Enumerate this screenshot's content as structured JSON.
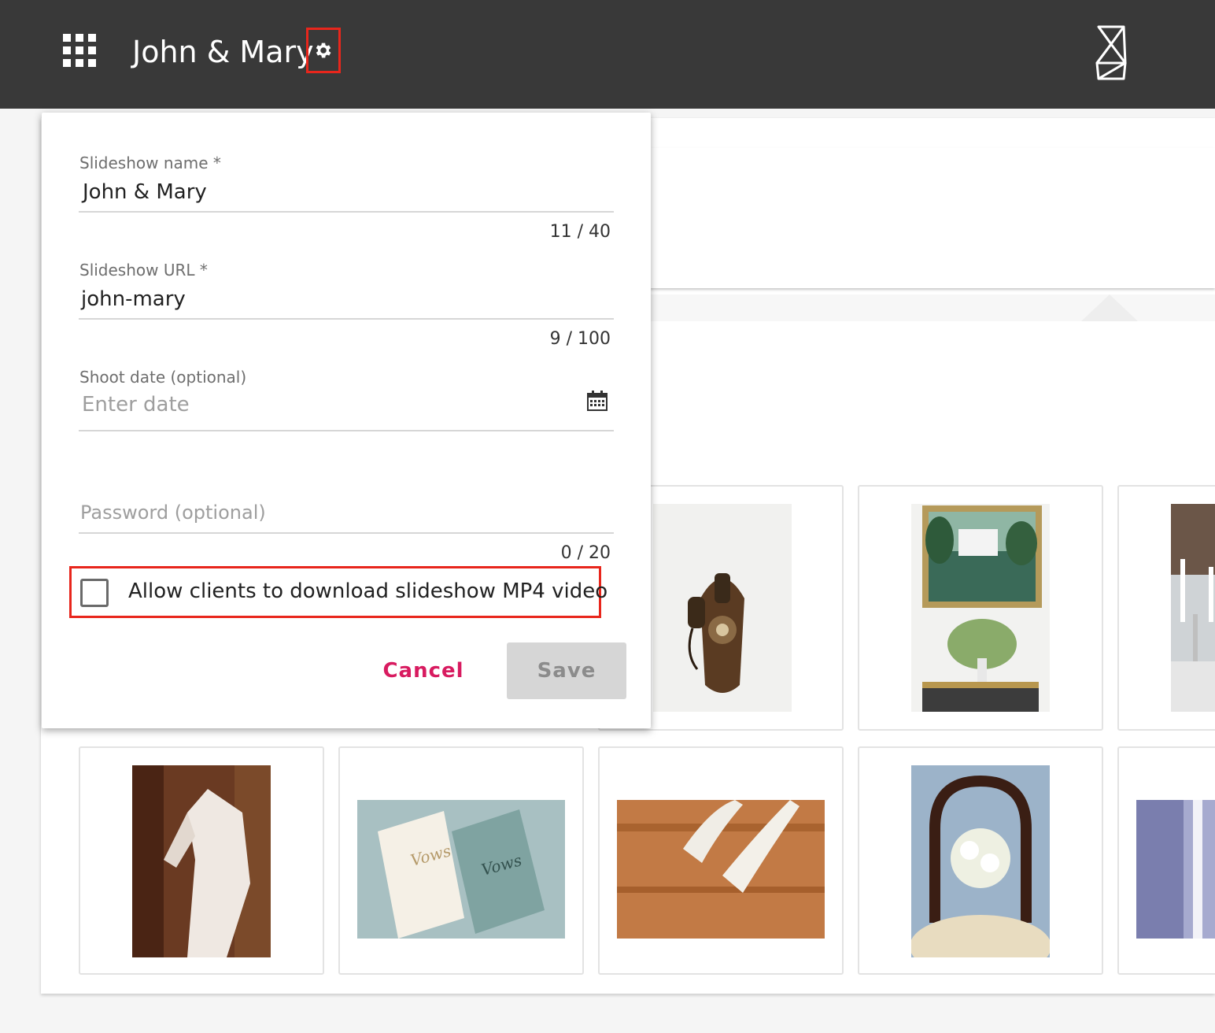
{
  "header": {
    "title": "John & Mary",
    "apps_icon": "apps-grid-icon",
    "settings_icon": "gear-icon",
    "brand_icon": "hourglass-logo-icon",
    "background_color": "#393939"
  },
  "dialog": {
    "name_field": {
      "label": "Slideshow name *",
      "value": "John & Mary",
      "counter": "11 / 40"
    },
    "url_field": {
      "label": "Slideshow URL *",
      "value": "john-mary",
      "counter": "9 / 100"
    },
    "date_field": {
      "label": "Shoot date (optional)",
      "placeholder": "Enter date",
      "icon": "calendar-icon"
    },
    "password_field": {
      "placeholder": "Password (optional)",
      "counter": "0 / 20"
    },
    "download_checkbox": {
      "label": "Allow clients to download slideshow MP4 video",
      "checked": false
    },
    "cancel_label": "Cancel",
    "save_label": "Save",
    "accent_color": "#d81b60"
  },
  "gallery": {
    "photos": [
      "telephone-photo",
      "painting-flowers-photo",
      "candelabra-photo",
      "lace-dress-photo",
      "vows-booklets-photo",
      "bridal-shoes-photo",
      "bouquet-chair-photo",
      "window-light-photo"
    ]
  }
}
